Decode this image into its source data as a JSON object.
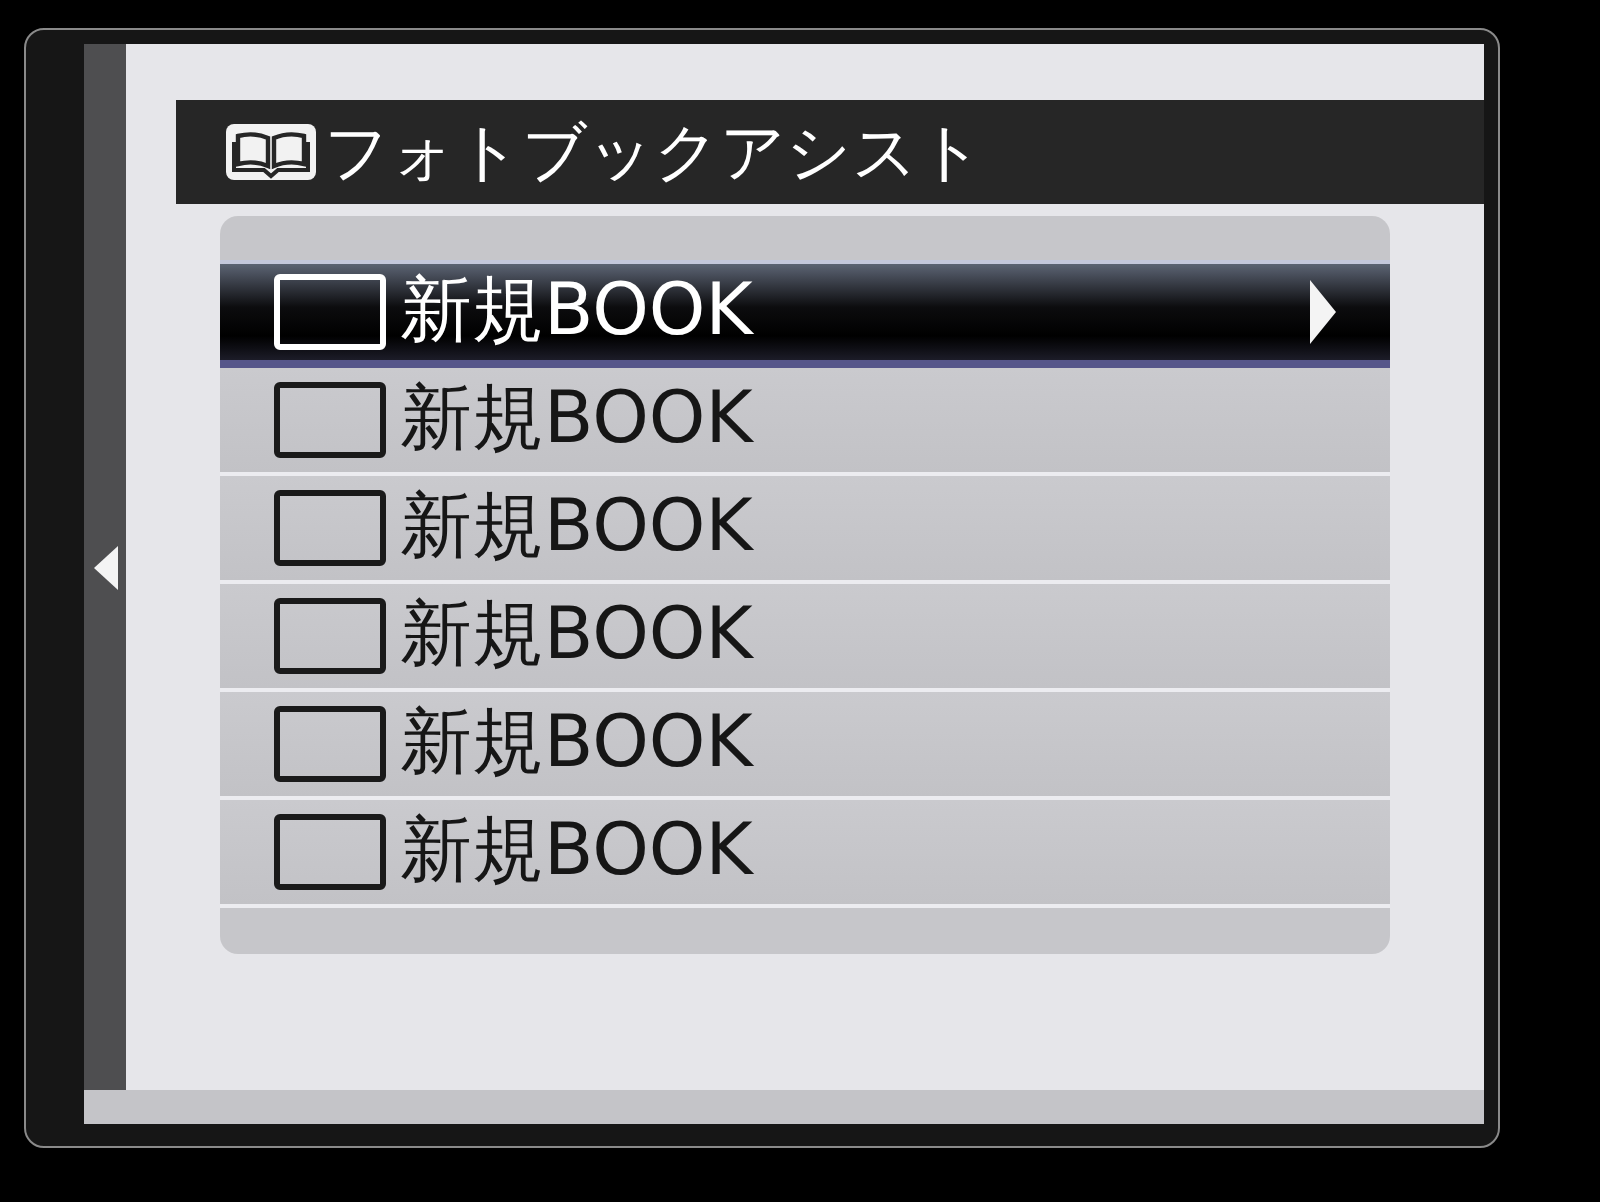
{
  "screen": {
    "title": "フォトブックアシスト",
    "book_list": {
      "items": [
        {
          "label": "新規BOOK",
          "selected": true,
          "checked": false
        },
        {
          "label": "新規BOOK",
          "selected": false,
          "checked": false
        },
        {
          "label": "新規BOOK",
          "selected": false,
          "checked": false
        },
        {
          "label": "新規BOOK",
          "selected": false,
          "checked": false
        },
        {
          "label": "新規BOOK",
          "selected": false,
          "checked": false
        },
        {
          "label": "新規BOOK",
          "selected": false,
          "checked": false
        }
      ]
    }
  }
}
